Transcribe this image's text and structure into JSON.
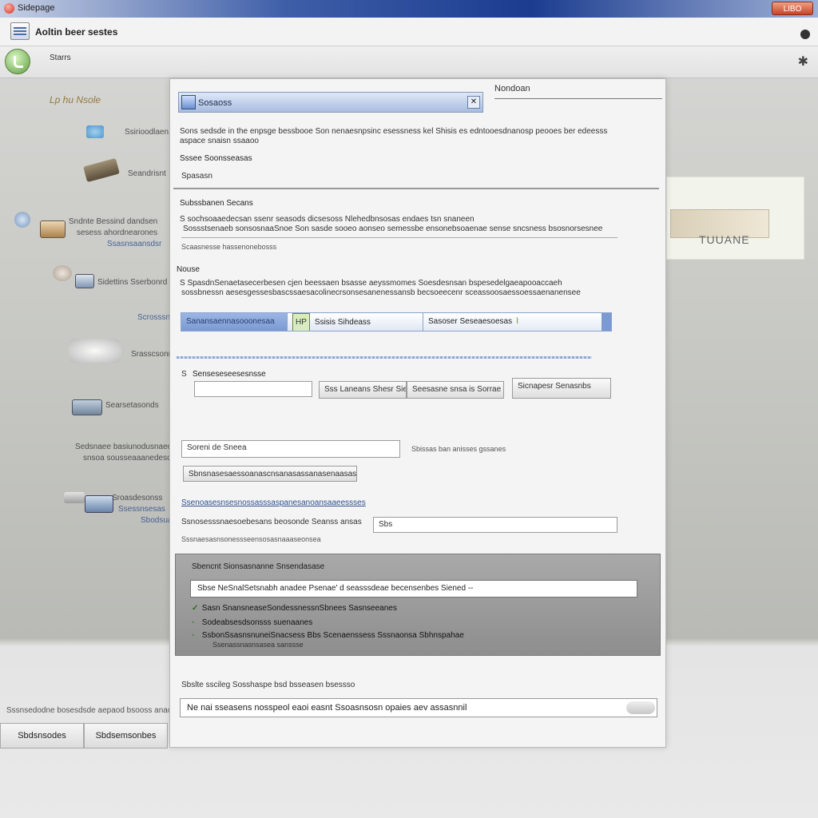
{
  "window": {
    "title": "Sidepage",
    "control_label": "LIBO"
  },
  "address": {
    "text": "Aoltin beer sestes"
  },
  "toolbar": {
    "label": "Starrs"
  },
  "left_items": [
    {
      "text": "Lp hu Nsole"
    },
    {
      "text": "Ssirioodlaen"
    },
    {
      "text": "Seandrisnt"
    },
    {
      "text": "Sndnte Bessind dandsen"
    },
    {
      "text": "sesess ahordnearones"
    },
    {
      "text": "Ssasnsaansdsr"
    },
    {
      "text": "Sidettins Sserbonrd"
    },
    {
      "text": "Scrosssnnte"
    },
    {
      "text": "Srasscsonrds"
    },
    {
      "text": "Searsetasonds"
    },
    {
      "text": "Sedsnaee basiunodusnaeonene"
    },
    {
      "text": "snsoa sousseaaanedesconsa"
    },
    {
      "text": "Sroasdesonss"
    },
    {
      "text": "Ssessnsesas"
    },
    {
      "text": "Sbodsuasa"
    }
  ],
  "left_bottom": {
    "text": "Sssnsedodne bosesdsde aepaod bsooss anaon"
  },
  "left_tabs": [
    {
      "label": "Sbdsnsodes"
    },
    {
      "label": "Sbdsemsonbes"
    }
  ],
  "right_panel": {
    "thumb_text": "TUUANE"
  },
  "dialog": {
    "caption": "Sosaoss",
    "right_title": "Nondoan",
    "intro": "Sons sedsde in the enpsge bessbooe Son nenaesnpsinc esessness kel Shisis es edntooesdnanosp peooes ber edeesss",
    "intro2": "aspace snaisn ssaaoo",
    "link1": "Sssee Soonsseasas",
    "label1": "Spasasn",
    "section_title": "Subssbanen Secans",
    "section_text": "S sochsoaaedecsan ssenr seasods dicsesoss Nlehedbnsosas endaes tsn snaneen",
    "section_text2": "Sossstsenaeb sonsosnaaSnoe Son sasde sooeo aonseo semessbe ensonebsoaenae sense sncsness bsosnorsesnee",
    "section_sub": "Scaasnesse hassenonebosss",
    "label2": "Nouse",
    "section2_text": "S SpasdnSenaetasecerbesen cjen beessaen bsasse aeyssmomes Soesdesnsan bspesedelgaeapooaccaeh",
    "section2_text2": "sossbnessn aesesgessesbascssaesacolinecrsonsesanenessansb becsoeecenr sceassoosaessoessaenanensee",
    "tabs": [
      {
        "label": "Sanansaennasooonesaa"
      },
      {
        "label": "Ssisis Sihdeass",
        "badge": "HP"
      },
      {
        "label": "Sasoser Seseaesoesas"
      }
    ],
    "row2_title": "Senseseseesesnsse",
    "row2_label": "S",
    "row2_inputs": [
      {
        "value": ""
      },
      {
        "value": "Sss Laneans Shesr Sie"
      },
      {
        "value": "Seesasne snsa is Sorrae"
      },
      {
        "value": "Sicnapesr Senasnbs"
      }
    ],
    "search": {
      "value": "Soreni de Sneea",
      "hint": "Sbissas ban anisses gssanes"
    },
    "button1": "Sbnsnasesaessoanascnsanasassanasenaasasee",
    "link2": "Ssenoasesnsesnossasssaspanesanoansaaeessses",
    "row3_label": "Ssnosesssnaesoebesans beosonde Seanss ansas",
    "row3_input": "Sbs",
    "row3_sub": "Sssnaesasnsonessseensosasnaaaseonsea",
    "panel": {
      "title": "Sbencnt Sionsasnanne Snsendasase",
      "input": "Sbse NeSnalSetsnabh anadee Psenae' d seasssdeae becensenbes Siened --",
      "options": [
        {
          "mark": "✓",
          "text": "Sasn SnansneaseSondessnessnSbnees Sasnseeanes"
        },
        {
          "mark": "◦",
          "text": "Sodeabsesdsonsss suenaanes"
        },
        {
          "mark": "◦",
          "text": "SsbonSsasnsnuneiSnacsess Bbs Scenaenssess Sssnaonsa Sbhnspahae"
        }
      ],
      "option_sub": "Ssenassnasnsasea sanssse"
    },
    "bottom_label": "Sbslte sscileg Sosshaspe bsd bsseasen bsessso",
    "bottom_input": "Ne nai sseasens nosspeol eaoi easnt Ssoasnsosn opaies aev assasnnil"
  }
}
